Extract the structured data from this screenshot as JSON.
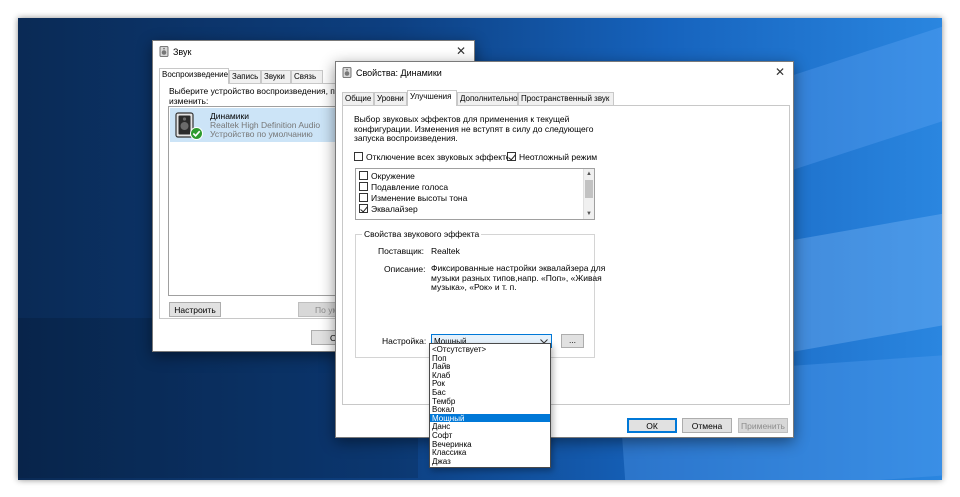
{
  "sound_window": {
    "title": "Звук",
    "tabs": [
      "Воспроизведение",
      "Запись",
      "Звуки",
      "Связь"
    ],
    "instruction": "Выберите устройство воспроизведения, пара\nизменить:",
    "device": {
      "name": "Динамики",
      "driver": "Realtek High Definition Audio",
      "status": "Устройство по умолчанию"
    },
    "configure_label": "Настроить",
    "default_label_partial": "По ум",
    "ok_partial": "О"
  },
  "props_window": {
    "title": "Свойства: Динамики",
    "tabs": [
      "Общие",
      "Уровни",
      "Улучшения",
      "Дополнительно",
      "Пространственный звук"
    ],
    "active_tab": 2,
    "description": "Выбор звуковых эффектов для применения к текущей\nконфигурации. Изменения не вступят в силу до следующего\nзапуска воспроизведения.",
    "disable_all_label": "Отключение всех звуковых эффектов",
    "immediate_mode_label": "Неотложный режим",
    "effects": [
      {
        "label": "Окружение",
        "checked": false
      },
      {
        "label": "Подавление голоса",
        "checked": false
      },
      {
        "label": "Изменение высоты тона",
        "checked": false
      },
      {
        "label": "Эквалайзер",
        "checked": true
      }
    ],
    "effect_props": {
      "group_title": "Свойства звукового эффекта",
      "provider_label": "Поставщик:",
      "provider_value": "Realtek",
      "description_label": "Описание:",
      "description_value": "Фиксированные настройки эквалайзера для\nмузыки разных типов,напр. «Поп», «Живая\nмузыка», «Рок» и т. п.",
      "setting_label": "Настройка:",
      "setting_value": "Мощный",
      "more_button": "..."
    },
    "presets": [
      "<Отсутствует>",
      "Поп",
      "Лайв",
      "Клаб",
      "Рок",
      "Бас",
      "Тембр",
      "Вокал",
      "Мощный",
      "Данс",
      "Софт",
      "Вечеринка",
      "Классика",
      "Джаз"
    ],
    "selected_preset_index": 8,
    "ok_label": "ОК",
    "cancel_label": "Отмена",
    "apply_label": "Применить"
  },
  "colors": {
    "selection": "#0078d7",
    "default_badge": "#2e9b2e"
  }
}
